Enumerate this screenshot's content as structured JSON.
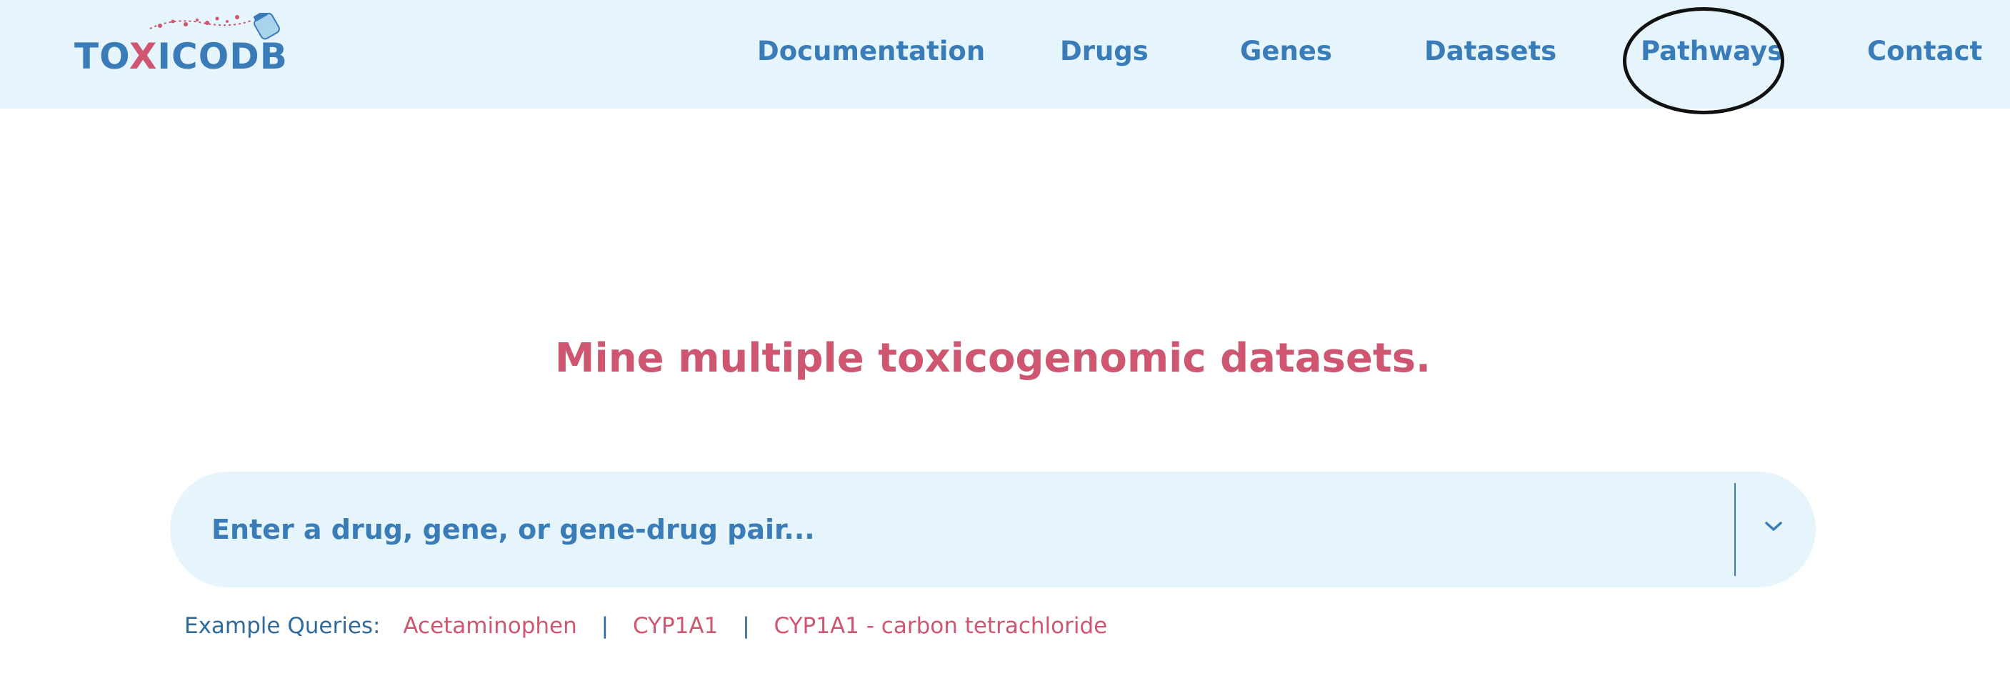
{
  "logo": {
    "text_before": "TO",
    "text_x": "X",
    "text_after": "ICODB",
    "icon": "pill-bottle-icon"
  },
  "nav": {
    "items": [
      {
        "label": "Documentation"
      },
      {
        "label": "Drugs"
      },
      {
        "label": "Genes"
      },
      {
        "label": "Datasets"
      },
      {
        "label": "Pathways"
      },
      {
        "label": "Contact"
      }
    ]
  },
  "hero": {
    "headline": "Mine multiple toxicogenomic datasets."
  },
  "search": {
    "placeholder": "Enter a drug, gene, or gene-drug pair...",
    "value": "",
    "dropdown_icon": "chevron-down-icon"
  },
  "examples": {
    "label": "Example Queries:",
    "items": [
      {
        "label": "Acetaminophen"
      },
      {
        "label": "CYP1A1"
      },
      {
        "label": "CYP1A1 - carbon tetrachloride"
      }
    ],
    "separator": "|"
  },
  "colors": {
    "header_bg": "#e6f4fb",
    "primary_blue": "#3a7cb8",
    "accent_pink": "#cf5670",
    "annotation_circle": "#111111"
  }
}
